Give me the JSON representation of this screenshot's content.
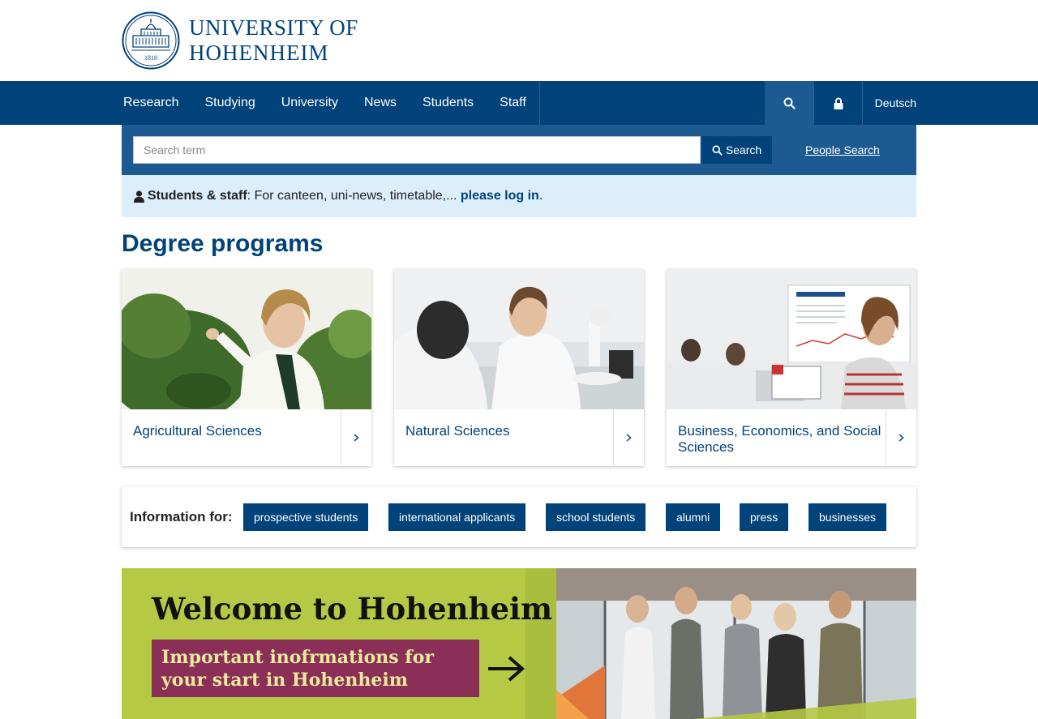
{
  "header": {
    "logo": {
      "line1": "UNIVERSITY OF",
      "line2": "HOHENHEIM",
      "seal_text": "1818"
    }
  },
  "nav": {
    "items": [
      "Research",
      "Studying",
      "University",
      "News",
      "Students",
      "Staff"
    ],
    "search_icon": "search-icon",
    "lock_icon": "lock-icon",
    "language": "Deutsch"
  },
  "search": {
    "placeholder": "Search term",
    "button_label": "Search",
    "people_search": "People Search"
  },
  "notice": {
    "strong": "Students & staff",
    "text": ": For canteen, uni-news, timetable,... ",
    "link": "please log in",
    "end": "."
  },
  "degree": {
    "heading": "Degree programs",
    "cards": [
      {
        "title": "Agricultural Sciences"
      },
      {
        "title": "Natural Sciences"
      },
      {
        "title": "Business, Economics, and Social Sciences"
      }
    ]
  },
  "info": {
    "label": "Information for:",
    "tags": [
      "prospective students",
      "international applicants",
      "school students",
      "alumni",
      "press",
      "businesses"
    ]
  },
  "banner": {
    "title": "Welcome to Hohenheim",
    "subtitle": "Important inofrmations for your start in Hohenheim"
  },
  "colors": {
    "primary": "#00427a",
    "nav_active": "#1e5a92",
    "notice_bg": "#dceefa",
    "banner_green": "#b5c945",
    "banner_purple": "#8b2f58"
  }
}
